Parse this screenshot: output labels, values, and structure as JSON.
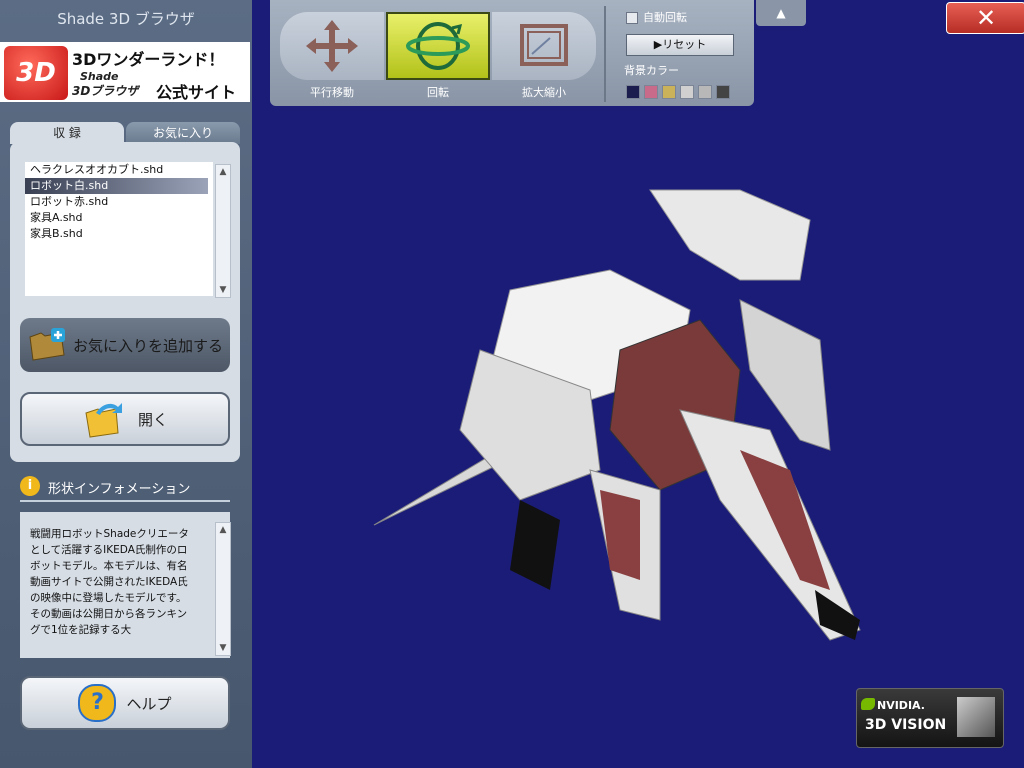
{
  "app_title": "Shade 3D ブラウザ",
  "banner": {
    "logo": "3D",
    "line1": "3Dワンダーランド！",
    "line2": "Shade",
    "line3": "3Dブラウザ",
    "line4": "公式サイト"
  },
  "tabs": [
    {
      "label": "収 録"
    },
    {
      "label": "お気に入り"
    }
  ],
  "files": [
    {
      "name": "ヘラクレスオオカブト.shd"
    },
    {
      "name": "ロボット白.shd"
    },
    {
      "name": "ロボット赤.shd"
    },
    {
      "name": "家具A.shd"
    },
    {
      "name": "家具B.shd"
    }
  ],
  "buttons": {
    "add_favorite": "お気に入りを追加する",
    "open": "開く",
    "help": "ヘルプ"
  },
  "info": {
    "heading": "形状インフォメーション",
    "text": "戦闘用ロボットShadeクリエータとして活躍するIKEDA氏制作のロボットモデル。本モデルは、有名動画サイトで公開されたIKEDA氏の映像中に登場したモデルです。その動画は公開日から各ランキングで1位を記録する大"
  },
  "toolbar": {
    "move": "平行移動",
    "rotate": "回転",
    "zoom": "拡大縮小",
    "auto_rotate": "自動回転",
    "reset": "▶リセット",
    "bg_color": "背景カラー"
  },
  "swatches": [
    "#1a1d4e",
    "#c86a8a",
    "#c9b25a",
    "#d0d0d0",
    "#b8b8b8",
    "#444444"
  ],
  "nvidia": {
    "line1": "NVIDIA.",
    "line2": "3D VISION"
  },
  "colors": {
    "viewport": "#1b1c78",
    "sidebar": "#52627a",
    "rotate_active": "#c8d43a",
    "close": "#d9443a"
  }
}
